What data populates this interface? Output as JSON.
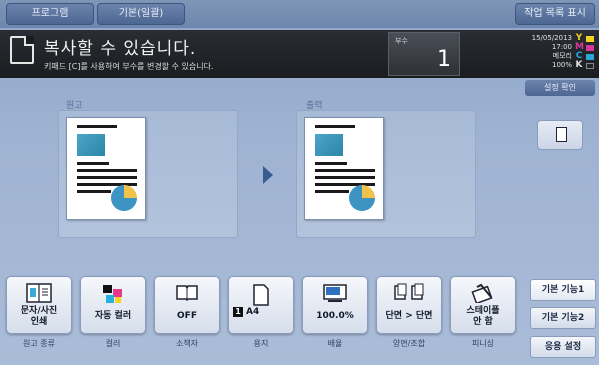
{
  "tabs": {
    "program": "프로그램",
    "basic": "기본(일괄)",
    "job_list": "작업 목록 표시"
  },
  "message": {
    "main": "복사할 수 있습니다.",
    "sub": "키패드 [C]를 사용하여 부수를 변경할 수 있습니다."
  },
  "copies": {
    "label": "부수",
    "value": "1"
  },
  "status": {
    "date": "15/05/2013",
    "time": "17:00",
    "memory_label": "메모리",
    "memory_value": "100%",
    "toner": [
      {
        "letter": "Y",
        "color": "#f4d21f"
      },
      {
        "letter": "M",
        "color": "#d9379a"
      },
      {
        "letter": "C",
        "color": "#2aa7d9"
      },
      {
        "letter": "K",
        "color": "#222222"
      }
    ]
  },
  "confirm_settings": "설정 확인",
  "preview": {
    "original_label": "원고",
    "output_label": "출력"
  },
  "functions": [
    {
      "value": "문자/사진\n인쇄",
      "category": "원고 종류"
    },
    {
      "value": "자동 컬러",
      "category": "컬러"
    },
    {
      "value": "OFF",
      "category": "소책자"
    },
    {
      "value": "A4",
      "category": "용지"
    },
    {
      "value": "100.0%",
      "category": "배율"
    },
    {
      "value": "단면 > 단면",
      "category": "양면/조합"
    },
    {
      "value": "스테이플\n안 함",
      "category": "피니싱"
    }
  ],
  "side_menu": {
    "basic1": "기본 기능1",
    "basic2": "기본 기능2",
    "common": "응용 설정"
  }
}
